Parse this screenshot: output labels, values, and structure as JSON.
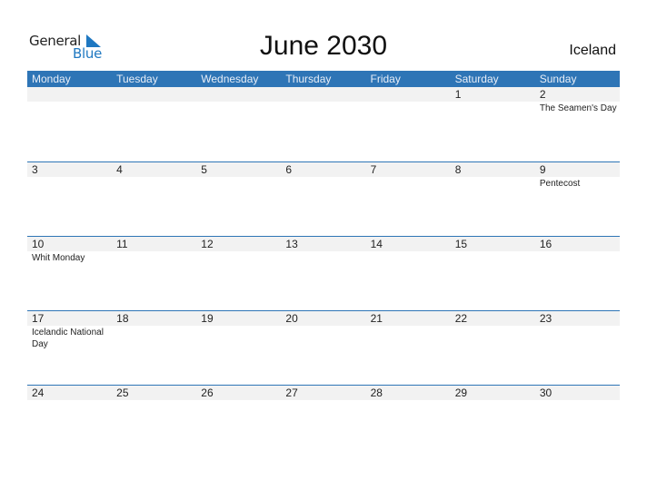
{
  "logo": {
    "general": "General",
    "blue": "Blue"
  },
  "header": {
    "title": "June 2030",
    "country": "Iceland"
  },
  "weekdays": [
    "Monday",
    "Tuesday",
    "Wednesday",
    "Thursday",
    "Friday",
    "Saturday",
    "Sunday"
  ],
  "colors": {
    "accent": "#2e75b6",
    "band": "#f2f2f2",
    "logo_blue": "#1f78c1"
  },
  "weeks": [
    [
      {
        "day": ""
      },
      {
        "day": ""
      },
      {
        "day": ""
      },
      {
        "day": ""
      },
      {
        "day": ""
      },
      {
        "day": "1"
      },
      {
        "day": "2",
        "event": "The Seamen's Day"
      }
    ],
    [
      {
        "day": "3"
      },
      {
        "day": "4"
      },
      {
        "day": "5"
      },
      {
        "day": "6"
      },
      {
        "day": "7"
      },
      {
        "day": "8"
      },
      {
        "day": "9",
        "event": "Pentecost"
      }
    ],
    [
      {
        "day": "10",
        "event": "Whit Monday"
      },
      {
        "day": "11"
      },
      {
        "day": "12"
      },
      {
        "day": "13"
      },
      {
        "day": "14"
      },
      {
        "day": "15"
      },
      {
        "day": "16"
      }
    ],
    [
      {
        "day": "17",
        "event": "Icelandic National Day"
      },
      {
        "day": "18"
      },
      {
        "day": "19"
      },
      {
        "day": "20"
      },
      {
        "day": "21"
      },
      {
        "day": "22"
      },
      {
        "day": "23"
      }
    ],
    [
      {
        "day": "24"
      },
      {
        "day": "25"
      },
      {
        "day": "26"
      },
      {
        "day": "27"
      },
      {
        "day": "28"
      },
      {
        "day": "29"
      },
      {
        "day": "30"
      }
    ]
  ]
}
